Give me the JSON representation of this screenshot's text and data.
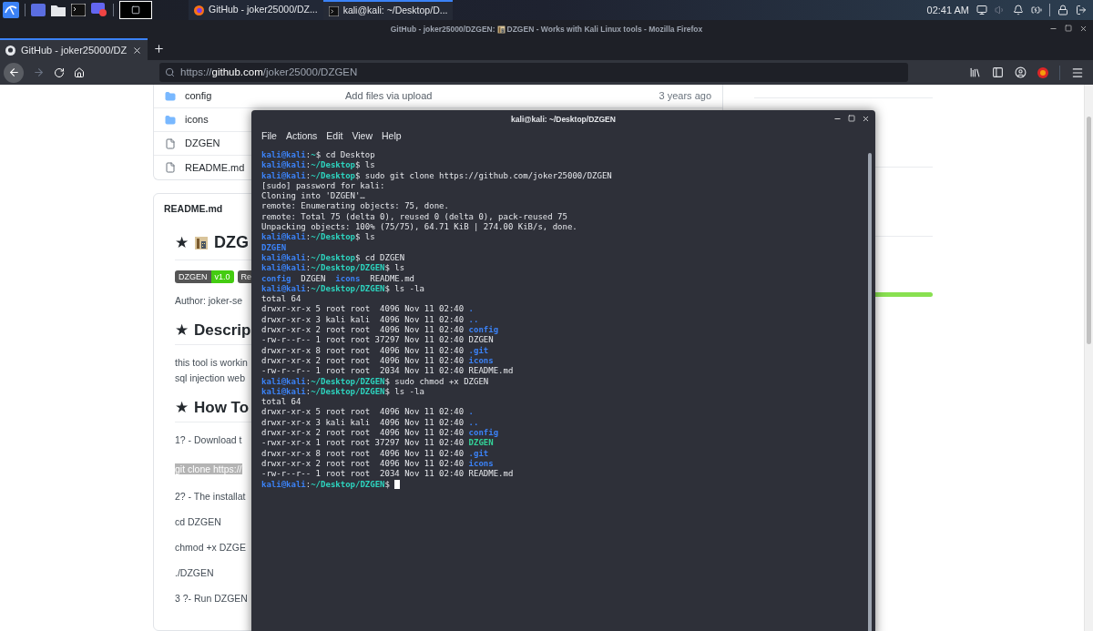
{
  "taskbar": {
    "tasks": [
      {
        "kind": "browser",
        "label": "GitHub - joker25000/DZ...",
        "selected": false
      },
      {
        "kind": "terminal",
        "label": "kali@kali: ~/Desktop/D...",
        "selected": true
      }
    ],
    "clock": "02:41 AM"
  },
  "browser": {
    "title_before": "GitHub - joker25000/DZGEN:",
    "title_after": "DZGEN - Works with Kali Linux tools - Mozilla Firefox",
    "tabs": [
      {
        "label": "GitHub - joker25000/DZ",
        "selected": true
      }
    ],
    "url": "https://**github.com**/joker25000/DZGEN"
  },
  "repo": {
    "files": [
      {
        "kind": "folder",
        "name": "config",
        "message": "Add files via upload",
        "age": "3 years ago"
      },
      {
        "kind": "folder",
        "name": "icons"
      },
      {
        "kind": "file",
        "name": "DZGEN"
      },
      {
        "kind": "file",
        "name": "README.md"
      }
    ]
  },
  "readme": {
    "title": "README.md",
    "heading": {
      "star": "★",
      "text": "DZG"
    },
    "badges": [
      {
        "text": "DZGEN",
        "color": "#555555"
      },
      {
        "text": "v1.0",
        "color": "#44cc11"
      },
      {
        "text": "Re",
        "color": "#555555"
      }
    ],
    "blocks": [
      {
        "kind": "p",
        "lines": [
          "Author: joker-se"
        ]
      },
      {
        "kind": "h2",
        "star": "★",
        "text": "Descrip"
      },
      {
        "kind": "p",
        "lines": [
          "this tool is workin",
          "sql injection web"
        ]
      },
      {
        "kind": "h2",
        "star": "★",
        "text": "How To"
      },
      {
        "kind": "p",
        "lines": [
          "1? - Download t"
        ]
      },
      {
        "kind": "code",
        "lines": [
          "git clone https://"
        ]
      },
      {
        "kind": "p",
        "lines": [
          "2? - The installat"
        ]
      },
      {
        "kind": "p",
        "lines": [
          "cd DZGEN"
        ]
      },
      {
        "kind": "p",
        "lines": [
          "chmod +x DZGE"
        ]
      },
      {
        "kind": "p",
        "lines": [
          "./DZGEN"
        ]
      },
      {
        "kind": "p",
        "lines": [
          "3 ?- Run DZGEN"
        ]
      }
    ]
  },
  "terminal": {
    "title": "kali@kali: ~/Desktop/DZGEN",
    "menu": [
      "File",
      "Actions",
      "Edit",
      "View",
      "Help"
    ],
    "lines": [
      [
        {
          "kind": "user",
          "text": "kali@kali"
        },
        {
          "kind": "plain",
          "text": ":"
        },
        {
          "kind": "path",
          "text": "~"
        },
        {
          "kind": "plain",
          "text": "$ cd Desktop"
        }
      ],
      [
        {
          "kind": "user",
          "text": "kali@kali"
        },
        {
          "kind": "plain",
          "text": ":"
        },
        {
          "kind": "path",
          "text": "~/Desktop"
        },
        {
          "kind": "plain",
          "text": "$ ls"
        }
      ],
      [
        {
          "kind": "user",
          "text": "kali@kali"
        },
        {
          "kind": "plain",
          "text": ":"
        },
        {
          "kind": "path",
          "text": "~/Desktop"
        },
        {
          "kind": "plain",
          "text": "$ sudo git clone https://github.com/joker25000/DZGEN"
        }
      ],
      [
        {
          "kind": "plain",
          "text": "[sudo] password for kali:"
        }
      ],
      [
        {
          "kind": "plain",
          "text": "Cloning into 'DZGEN'…"
        }
      ],
      [
        {
          "kind": "plain",
          "text": "remote: Enumerating objects: 75, done."
        }
      ],
      [
        {
          "kind": "plain",
          "text": "remote: Total 75 (delta 0), reused 0 (delta 0), pack-reused 75"
        }
      ],
      [
        {
          "kind": "plain",
          "text": "Unpacking objects: 100% (75/75), 64.71 KiB | 274.00 KiB/s, done."
        }
      ],
      [
        {
          "kind": "user",
          "text": "kali@kali"
        },
        {
          "kind": "plain",
          "text": ":"
        },
        {
          "kind": "path",
          "text": "~/Desktop"
        },
        {
          "kind": "plain",
          "text": "$ ls"
        }
      ],
      [
        {
          "kind": "dir",
          "text": "DZGEN"
        }
      ],
      [
        {
          "kind": "user",
          "text": "kali@kali"
        },
        {
          "kind": "plain",
          "text": ":"
        },
        {
          "kind": "path",
          "text": "~/Desktop"
        },
        {
          "kind": "plain",
          "text": "$ cd DZGEN"
        }
      ],
      [
        {
          "kind": "user",
          "text": "kali@kali"
        },
        {
          "kind": "plain",
          "text": ":"
        },
        {
          "kind": "path",
          "text": "~/Desktop/DZGEN"
        },
        {
          "kind": "plain",
          "text": "$ ls"
        }
      ],
      [
        {
          "kind": "dir",
          "text": "config"
        },
        {
          "kind": "plain",
          "text": "  DZGEN  "
        },
        {
          "kind": "dir",
          "text": "icons"
        },
        {
          "kind": "plain",
          "text": "  README.md"
        }
      ],
      [
        {
          "kind": "user",
          "text": "kali@kali"
        },
        {
          "kind": "plain",
          "text": ":"
        },
        {
          "kind": "path",
          "text": "~/Desktop/DZGEN"
        },
        {
          "kind": "plain",
          "text": "$ ls -la"
        }
      ],
      [
        {
          "kind": "plain",
          "text": "total 64"
        }
      ],
      [
        {
          "kind": "plain",
          "text": "drwxr-xr-x 5 root root  4096 Nov 11 02:40 "
        },
        {
          "kind": "dir",
          "text": "."
        }
      ],
      [
        {
          "kind": "plain",
          "text": "drwxr-xr-x 3 kali kali  4096 Nov 11 02:40 "
        },
        {
          "kind": "dir",
          "text": ".."
        }
      ],
      [
        {
          "kind": "plain",
          "text": "drwxr-xr-x 2 root root  4096 Nov 11 02:40 "
        },
        {
          "kind": "dir",
          "text": "config"
        }
      ],
      [
        {
          "kind": "plain",
          "text": "-rw-r--r-- 1 root root 37297 Nov 11 02:40 DZGEN"
        }
      ],
      [
        {
          "kind": "plain",
          "text": "drwxr-xr-x 8 root root  4096 Nov 11 02:40 "
        },
        {
          "kind": "dir",
          "text": ".git"
        }
      ],
      [
        {
          "kind": "plain",
          "text": "drwxr-xr-x 2 root root  4096 Nov 11 02:40 "
        },
        {
          "kind": "dir",
          "text": "icons"
        }
      ],
      [
        {
          "kind": "plain",
          "text": "-rw-r--r-- 1 root root  2034 Nov 11 02:40 README.md"
        }
      ],
      [
        {
          "kind": "user",
          "text": "kali@kali"
        },
        {
          "kind": "plain",
          "text": ":"
        },
        {
          "kind": "path",
          "text": "~/Desktop/DZGEN"
        },
        {
          "kind": "plain",
          "text": "$ sudo chmod +x DZGEN"
        }
      ],
      [
        {
          "kind": "user",
          "text": "kali@kali"
        },
        {
          "kind": "plain",
          "text": ":"
        },
        {
          "kind": "path",
          "text": "~/Desktop/DZGEN"
        },
        {
          "kind": "plain",
          "text": "$ ls -la"
        }
      ],
      [
        {
          "kind": "plain",
          "text": "total 64"
        }
      ],
      [
        {
          "kind": "plain",
          "text": "drwxr-xr-x 5 root root  4096 Nov 11 02:40 "
        },
        {
          "kind": "dir",
          "text": "."
        }
      ],
      [
        {
          "kind": "plain",
          "text": "drwxr-xr-x 3 kali kali  4096 Nov 11 02:40 "
        },
        {
          "kind": "dir",
          "text": ".."
        }
      ],
      [
        {
          "kind": "plain",
          "text": "drwxr-xr-x 2 root root  4096 Nov 11 02:40 "
        },
        {
          "kind": "dir",
          "text": "config"
        }
      ],
      [
        {
          "kind": "plain",
          "text": "-rwxr-xr-x 1 root root 37297 Nov 11 02:40 "
        },
        {
          "kind": "exec",
          "text": "DZGEN"
        }
      ],
      [
        {
          "kind": "plain",
          "text": "drwxr-xr-x 8 root root  4096 Nov 11 02:40 "
        },
        {
          "kind": "dir",
          "text": ".git"
        }
      ],
      [
        {
          "kind": "plain",
          "text": "drwxr-xr-x 2 root root  4096 Nov 11 02:40 "
        },
        {
          "kind": "dir",
          "text": "icons"
        }
      ],
      [
        {
          "kind": "plain",
          "text": "-rw-r--r-- 1 root root  2034 Nov 11 02:40 README.md"
        }
      ],
      [
        {
          "kind": "user",
          "text": "kali@kali"
        },
        {
          "kind": "plain",
          "text": ":"
        },
        {
          "kind": "path",
          "text": "~/Desktop/DZGEN"
        },
        {
          "kind": "plain",
          "text": "$ "
        },
        {
          "kind": "cursor"
        }
      ]
    ]
  }
}
